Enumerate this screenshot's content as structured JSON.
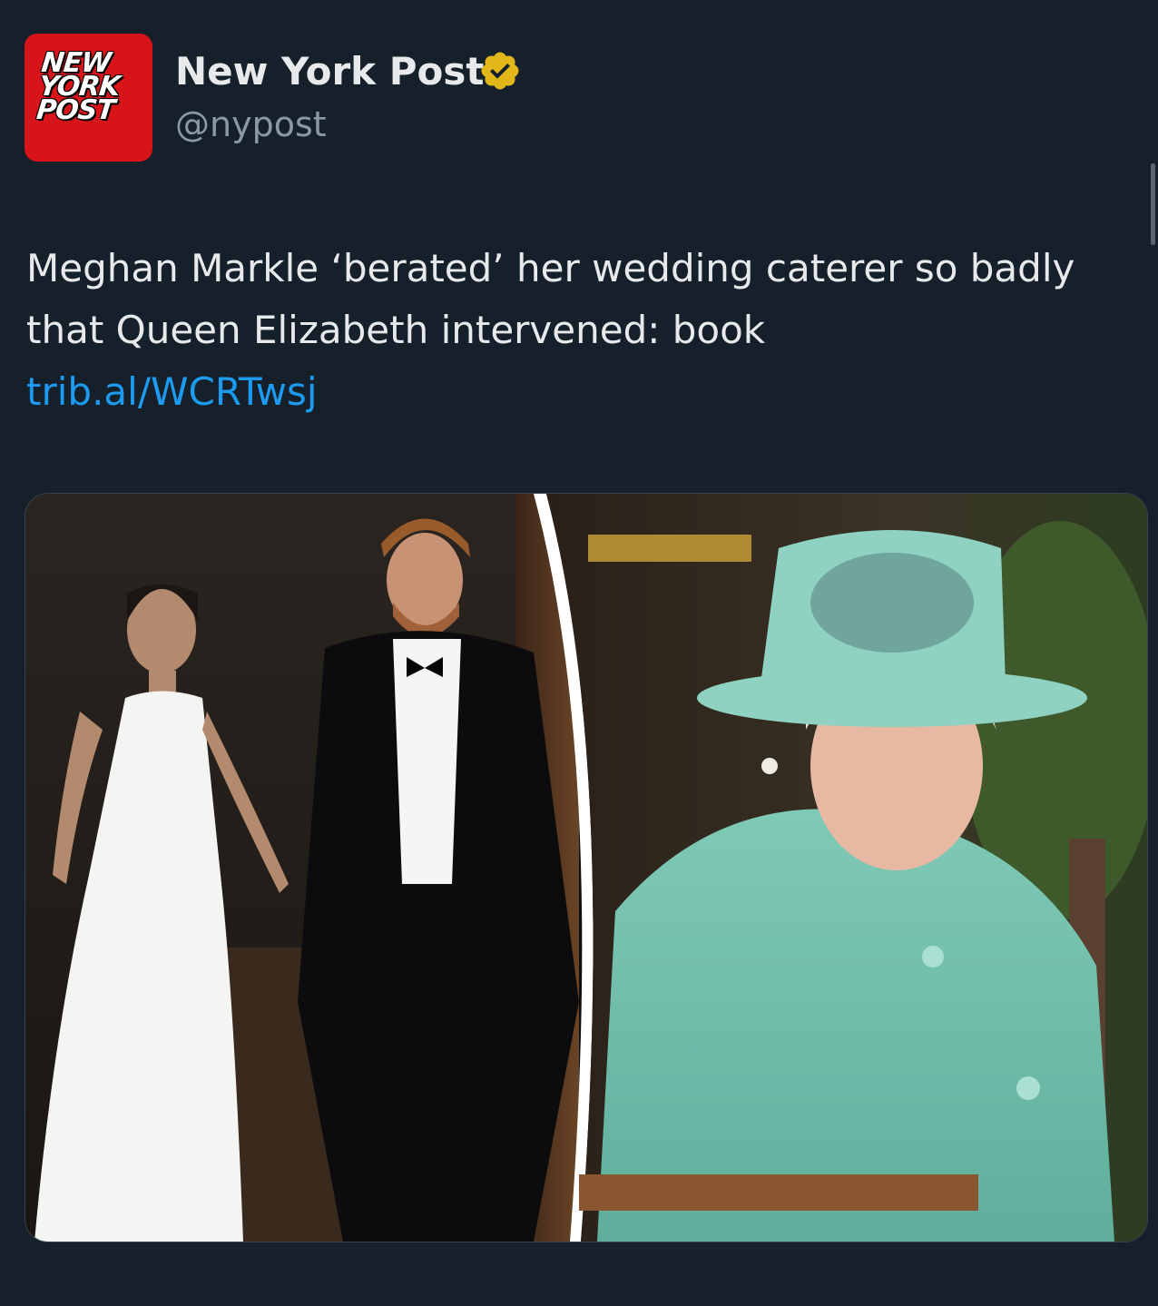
{
  "account": {
    "avatar_lines": [
      "NEW",
      "YORK",
      "POST"
    ],
    "display_name": "New York Post",
    "handle": "@nypost",
    "verified": true
  },
  "tweet": {
    "text": "Meghan Markle ‘berated’ her wedding caterer so badly that Queen Elizabeth intervened: book",
    "link": "trib.al/WCRTwsj"
  },
  "media": {
    "kind": "photo-collage"
  },
  "colors": {
    "background": "#15202b",
    "brand_red": "#d7141a",
    "link": "#1d9bf0",
    "badge": "#e2b719",
    "secondary_text": "#8b98a5"
  }
}
